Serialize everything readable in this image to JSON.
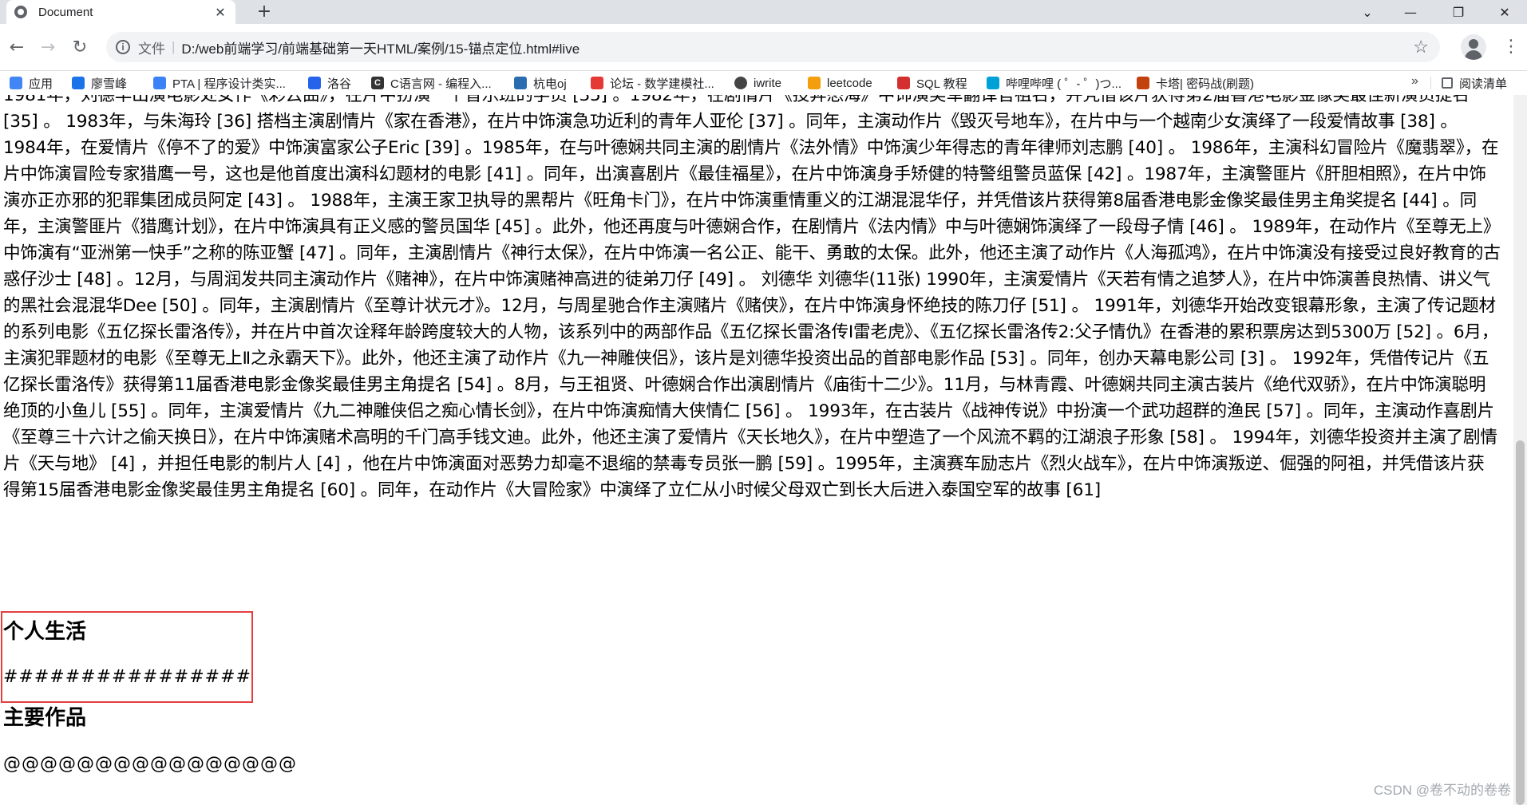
{
  "browser": {
    "tab_title": "Document",
    "tab_close": "✕",
    "new_tab": "+",
    "window_controls": [
      "⌄",
      "—",
      "❐",
      "✕"
    ],
    "back": "←",
    "forward": "→",
    "reload": "↻",
    "info_glyph": "i",
    "scheme_label": "文件",
    "separator": "|",
    "url": "D:/web前端学习/前端基础第一天HTML/案例/15-锚点定位.html#live",
    "star": "☆",
    "menu": "⋮"
  },
  "bookmarks": {
    "items": [
      {
        "label": "应用",
        "icon_color": "#4285f4",
        "icon": "grid-icon"
      },
      {
        "label": "廖雪峰",
        "icon_color": "#1a73e8",
        "icon": "bird-icon"
      },
      {
        "label": "PTA | 程序设计类实...",
        "icon_color": "#3b82f6",
        "icon": "pta-icon"
      },
      {
        "label": "洛谷",
        "icon_color": "#2563eb",
        "icon": "luogu-icon"
      },
      {
        "label": "C语言网 - 编程入...",
        "icon_color": "#333333",
        "icon": "c-icon"
      },
      {
        "label": "杭电oj",
        "icon_color": "#2b6cb0",
        "icon": "hdu-icon"
      },
      {
        "label": "论坛 - 数学建模社...",
        "icon_color": "#e53935",
        "icon": "forum-icon"
      },
      {
        "label": "iwrite",
        "icon_color": "#444444",
        "icon": "globe-icon"
      },
      {
        "label": "leetcode",
        "icon_color": "#f59e0b",
        "icon": "leetcode-icon"
      },
      {
        "label": "SQL 教程",
        "icon_color": "#d32f2f",
        "icon": "sql-icon"
      },
      {
        "label": "哔哩哔哩 ( ゜- ゜)つ...",
        "icon_color": "#00a1d6",
        "icon": "bilibili-icon"
      },
      {
        "label": "卡塔| 密码战(刷题)",
        "icon_color": "#c2410c",
        "icon": "codewars-icon"
      }
    ],
    "more": "»",
    "reading_list": "阅读清单"
  },
  "content": {
    "paragraph": "1981年，刘德华出演电影处女作《彩云曲》，在片中扮演一个音乐班的学员 [35] 。1982年，在剧情片《投奔怒海》中饰演美军翻译官祖名，并凭借该片获得第2届香港电影金像奖最佳新演员提名 [35] 。 1983年，与朱海玲 [36] 搭档主演剧情片《家在香港》，在片中饰演急功近利的青年人亚伦 [37] 。同年，主演动作片《毁灭号地车》，在片中与一个越南少女演绎了一段爱情故事 [38] 。 1984年，在爱情片《停不了的爱》中饰演富家公子Eric [39] 。1985年，在与叶德娴共同主演的剧情片《法外情》中饰演少年得志的青年律师刘志鹏 [40] 。 1986年，主演科幻冒险片《魔翡翠》，在片中饰演冒险专家猎鹰一号，这也是他首度出演科幻题材的电影 [41] 。同年，出演喜剧片《最佳福星》，在片中饰演身手矫健的特警组警员蓝保 [42] 。1987年，主演警匪片《肝胆相照》，在片中饰演亦正亦邪的犯罪集团成员阿定 [43] 。 1988年，主演王家卫执导的黑帮片《旺角卡门》，在片中饰演重情重义的江湖混混华仔，并凭借该片获得第8届香港电影金像奖最佳男主角奖提名 [44] 。同年，主演警匪片《猎鹰计划》，在片中饰演具有正义感的警员国华 [45] 。此外，他还再度与叶德娴合作，在剧情片《法内情》中与叶德娴饰演绎了一段母子情 [46] 。 1989年，在动作片《至尊无上》中饰演有“亚洲第一快手”之称的陈亚蟹 [47] 。同年，主演剧情片《神行太保》，在片中饰演一名公正、能干、勇敢的太保。此外，他还主演了动作片《人海孤鸿》，在片中饰演没有接受过良好教育的古惑仔沙士 [48] 。12月，与周润发共同主演动作片《赌神》，在片中饰演赌神高进的徒弟刀仔 [49] 。 刘德华 刘德华(11张) 1990年，主演爱情片《天若有情之追梦人》，在片中饰演善良热情、讲义气的黑社会混混华Dee [50] 。同年，主演剧情片《至尊计状元才》。12月，与周星驰合作主演赌片《赌侠》，在片中饰演身怀绝技的陈刀仔 [51] 。 1991年，刘德华开始改变银幕形象，主演了传记题材的系列电影《五亿探长雷洛传》，并在片中首次诠释年龄跨度较大的人物，该系列中的两部作品《五亿探长雷洛传Ⅰ雷老虎》、《五亿探长雷洛传2:父子情仇》在香港的累积票房达到5300万 [52] 。6月，主演犯罪题材的电影《至尊无上Ⅱ之永霸天下》。此外，他还主演了动作片《九一神雕侠侣》，该片是刘德华投资出品的首部电影作品 [53] 。同年，创办天幕电影公司 [3] 。 1992年，凭借传记片《五亿探长雷洛传》获得第11届香港电影金像奖最佳男主角提名 [54] 。8月，与王祖贤、叶德娴合作出演剧情片《庙街十二少》。11月，与林青霞、叶德娴共同主演古装片《绝代双骄》，在片中饰演聪明绝顶的小鱼儿 [55] 。同年，主演爱情片《九二神雕侠侣之痴心情长剑》，在片中饰演痴情大侠情仁 [56] 。 1993年，在古装片《战神传说》中扮演一个武功超群的渔民 [57] 。同年，主演动作喜剧片《至尊三十六计之偷天换日》，在片中饰演赌术高明的千门高手钱文迪。此外，他还主演了爱情片《天长地久》，在片中塑造了一个风流不羁的江湖浪子形象 [58] 。 1994年，刘德华投资并主演了剧情片《天与地》 [4] ，并担任电影的制片人 [4] ，他在片中饰演面对恶势力却毫不退缩的禁毒专员张一鹏 [59] 。1995年，主演赛车励志片《烈火战车》，在片中饰演叛逆、倔强的阿祖，并凭借该片获得第15届香港电影金像奖最佳男主角提名 [60] 。同年，在动作片《大冒险家》中演绎了立仁从小时候父母双亡到长大后进入泰国空军的故事 [61]",
    "section1_heading": "个人生活",
    "section1_text": "################",
    "section2_heading": "主要作品",
    "section2_text": "@@@@@@@@@@@@@@@@"
  },
  "watermark": "CSDN @卷不动的卷卷"
}
